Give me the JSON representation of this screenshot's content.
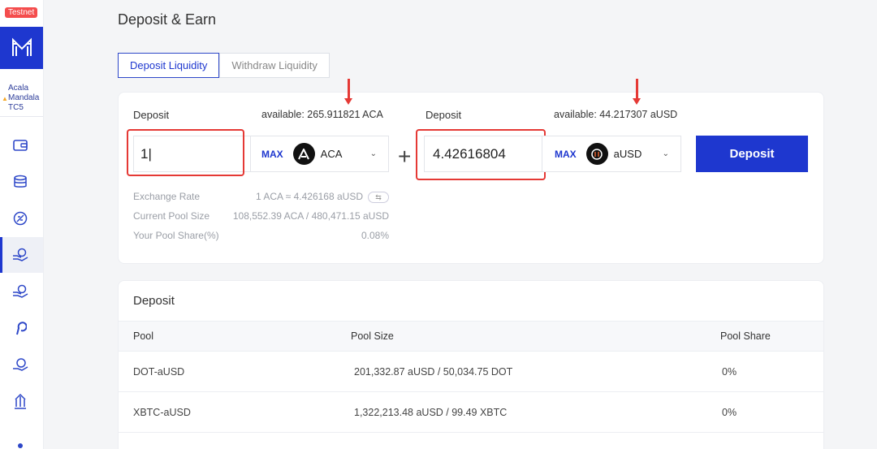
{
  "sidebar": {
    "badge": "Testnet",
    "network_lines": [
      "Acala",
      "Mandala",
      "TC5"
    ],
    "nav_icons": [
      "wallet-icon",
      "database-icon",
      "loan-icon",
      "swap-hand-icon",
      "earn-hand-icon",
      "polkadot-icon",
      "staking-icon",
      "governance-icon"
    ]
  },
  "page": {
    "title": "Deposit & Earn"
  },
  "tabs": [
    {
      "label": "Deposit Liquidity",
      "active": true
    },
    {
      "label": "Withdraw Liquidity",
      "active": false
    }
  ],
  "left_input": {
    "label": "Deposit",
    "available": "available: 265.911821 ACA",
    "value": "1|",
    "max_label": "MAX",
    "token": "ACA"
  },
  "right_input": {
    "label": "Deposit",
    "available": "available: 44.217307 aUSD",
    "value": "4.42616804",
    "max_label": "MAX",
    "token": "aUSD"
  },
  "deposit_button": "Deposit",
  "info": [
    {
      "label": "Exchange Rate",
      "value": "1 ACA ≈ 4.426168 aUSD"
    },
    {
      "label": "Current Pool Size",
      "value": "108,552.39 ACA / 480,471.15 aUSD"
    },
    {
      "label": "Your Pool Share(%)",
      "value": "0.08%"
    }
  ],
  "table": {
    "title": "Deposit",
    "headers": [
      "Pool",
      "Pool Size",
      "Pool Share"
    ],
    "rows": [
      {
        "pool": "DOT-aUSD",
        "size": "201,332.87 aUSD / 50,034.75 DOT",
        "share": "0%"
      },
      {
        "pool": "XBTC-aUSD",
        "size": "1,322,213.48 aUSD / 99.49 XBTC",
        "share": "0%"
      }
    ]
  },
  "colors": {
    "accent": "#1e37cf",
    "highlight": "#e53935",
    "testnet": "#f44d4d"
  }
}
